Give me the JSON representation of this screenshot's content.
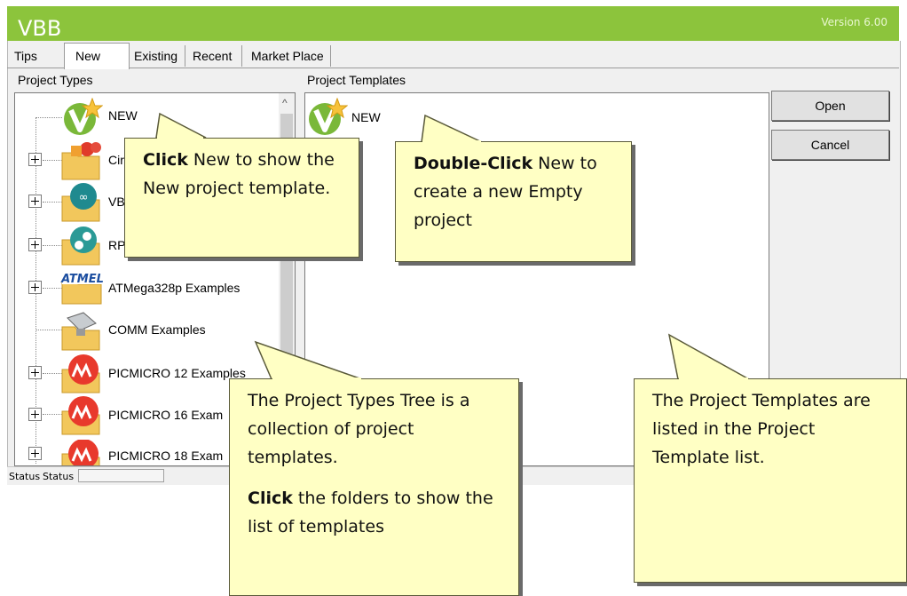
{
  "app": {
    "title": "VBB",
    "version": "Version 6.00"
  },
  "tabs": [
    {
      "label": "Tips"
    },
    {
      "label": "New"
    },
    {
      "label": "Existing"
    },
    {
      "label": "Recent"
    },
    {
      "label": "Market Place"
    }
  ],
  "project_types": {
    "heading": "Project Types",
    "items": [
      {
        "label": "NEW",
        "icon": "vbb-new-icon"
      },
      {
        "label": "Cir",
        "icon": "circuit-folder-icon"
      },
      {
        "label": "VB",
        "icon": "arduino-folder-icon"
      },
      {
        "label": "RP",
        "icon": "raspberry-folder-icon"
      },
      {
        "label": "ATMega328p Examples",
        "icon": "atmel-folder-icon"
      },
      {
        "label": "COMM Examples",
        "icon": "comm-folder-icon"
      },
      {
        "label": "PICMICRO 12 Examples",
        "icon": "microchip-folder-icon"
      },
      {
        "label": "PICMICRO 16 Exam",
        "icon": "microchip-folder-icon"
      },
      {
        "label": "PICMICRO 18 Exam",
        "icon": "microchip-folder-icon"
      }
    ]
  },
  "project_templates": {
    "heading": "Project Templates",
    "items": [
      {
        "label": "NEW",
        "icon": "vbb-new-icon"
      }
    ]
  },
  "buttons": {
    "open": "Open",
    "cancel": "Cancel"
  },
  "status": {
    "label1": "Status",
    "label2": "Status"
  },
  "callouts": {
    "click_new": {
      "bold": "Click",
      "text": " New to show the New project template."
    },
    "double_click": {
      "bold": "Double-Click",
      "text": " New to create a new Empty project"
    },
    "tree": {
      "line1": "The Project Types Tree is a collection of project templates.",
      "bold": "Click",
      "text": " the folders to show the list of templates"
    },
    "template_list": {
      "text": "The Project Templates are listed in the Project Template list."
    }
  },
  "colors": {
    "titlebar": "#8cc43c",
    "callout_fill": "#ffffc4"
  }
}
